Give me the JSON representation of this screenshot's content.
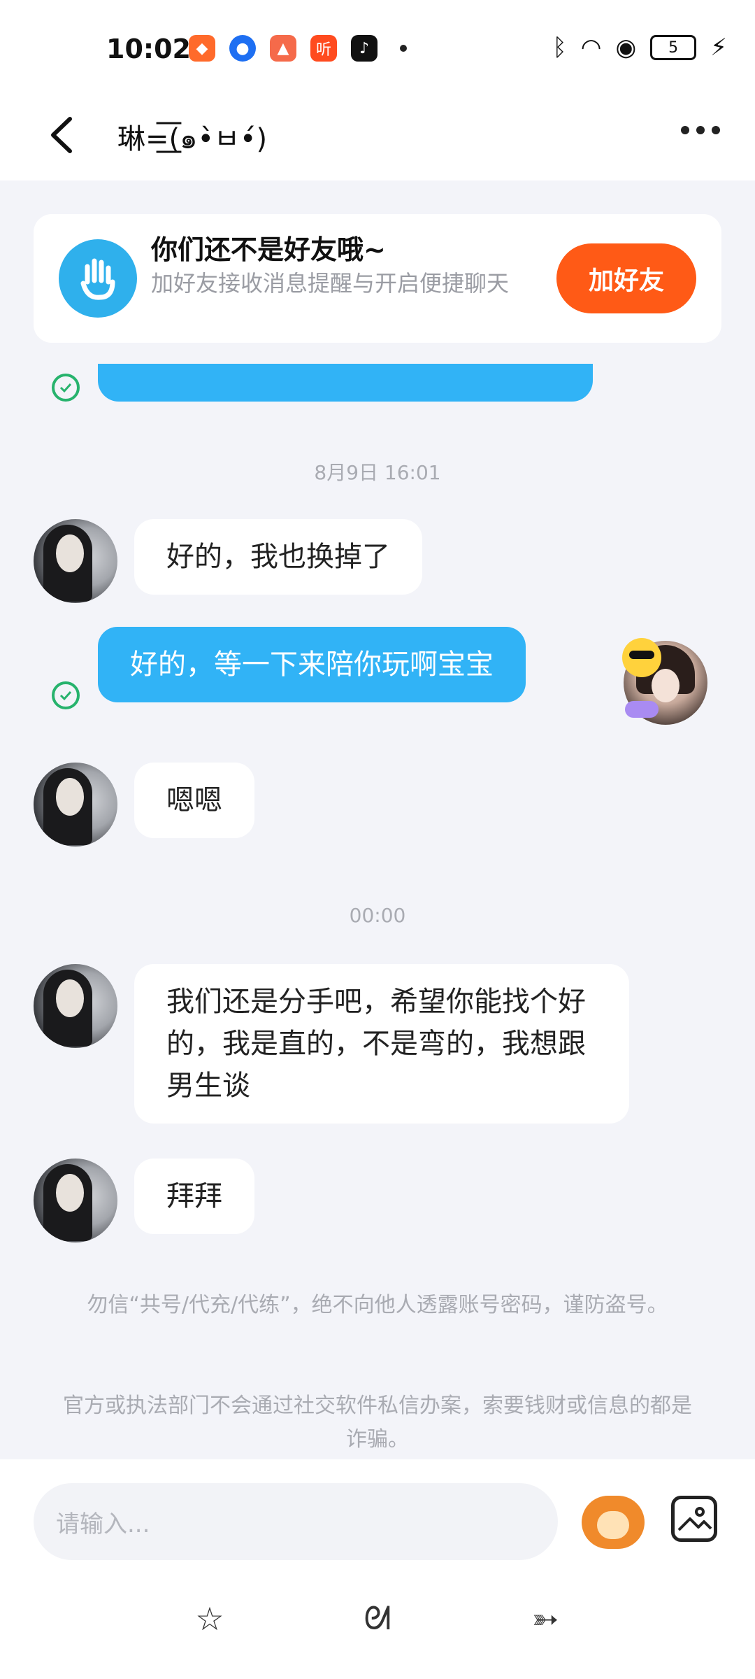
{
  "status_bar": {
    "time": "10:02",
    "battery": "5",
    "app_icon_listen": "听"
  },
  "header": {
    "contact_name": "琳=͟͟͞͞(๑•̀ㅂ•́)"
  },
  "banner": {
    "title": "你们还不是好友哦~",
    "subtitle": "加好友接收消息提醒与开启便捷聊天",
    "add_friend_button": "加好友"
  },
  "messages": [
    {
      "type": "time",
      "text": "8月9日 16:01"
    },
    {
      "type": "in",
      "text": "好的，我也换掉了"
    },
    {
      "type": "out",
      "text": "好的，等一下来陪你玩啊宝宝"
    },
    {
      "type": "in",
      "text": "嗯嗯"
    },
    {
      "type": "time",
      "text": "00:00"
    },
    {
      "type": "in",
      "text": "我们还是分手吧，希望你能找个好的，我是直的，不是弯的，我想跟男生谈"
    },
    {
      "type": "in",
      "text": "拜拜"
    }
  ],
  "notices": [
    "勿信“共号/代充/代练”，绝不向他人透露账号密码，谨防盗号。",
    "官方或执法部门不会通过社交软件私信办案，索要钱财或信息的都是诈骗。"
  ],
  "input": {
    "placeholder": "请输入..."
  },
  "colors": {
    "accent_blue": "#31b3f6",
    "add_button": "#ff5a16",
    "check_green": "#27b36d"
  }
}
